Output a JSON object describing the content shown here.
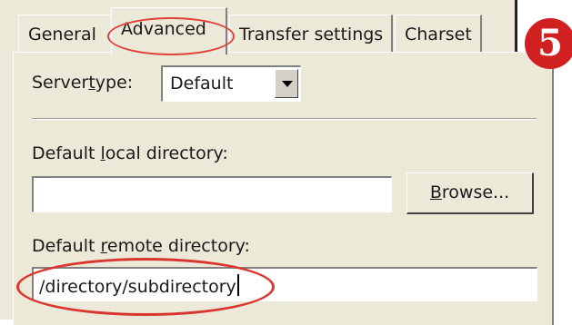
{
  "tabs": [
    {
      "label": "General"
    },
    {
      "label": "Advanced"
    },
    {
      "label": "Transfer settings"
    },
    {
      "label": "Charset"
    }
  ],
  "servertype": {
    "label_pre": "Server",
    "label_access": "t",
    "label_post": "ype:",
    "value": "Default"
  },
  "local_dir": {
    "label_pre": "Default ",
    "label_access": "l",
    "label_post": "ocal directory:",
    "value": ""
  },
  "browse": {
    "label_access": "B",
    "label_post": "rowse..."
  },
  "remote_dir": {
    "label_pre": "Default ",
    "label_access": "r",
    "label_post": "emote directory:",
    "value": "/directory/subdirectory"
  },
  "step_badge": "5",
  "colors": {
    "panel": "#ece9d8",
    "highlight_ring": "#d9362f",
    "badge": "#d02020"
  }
}
